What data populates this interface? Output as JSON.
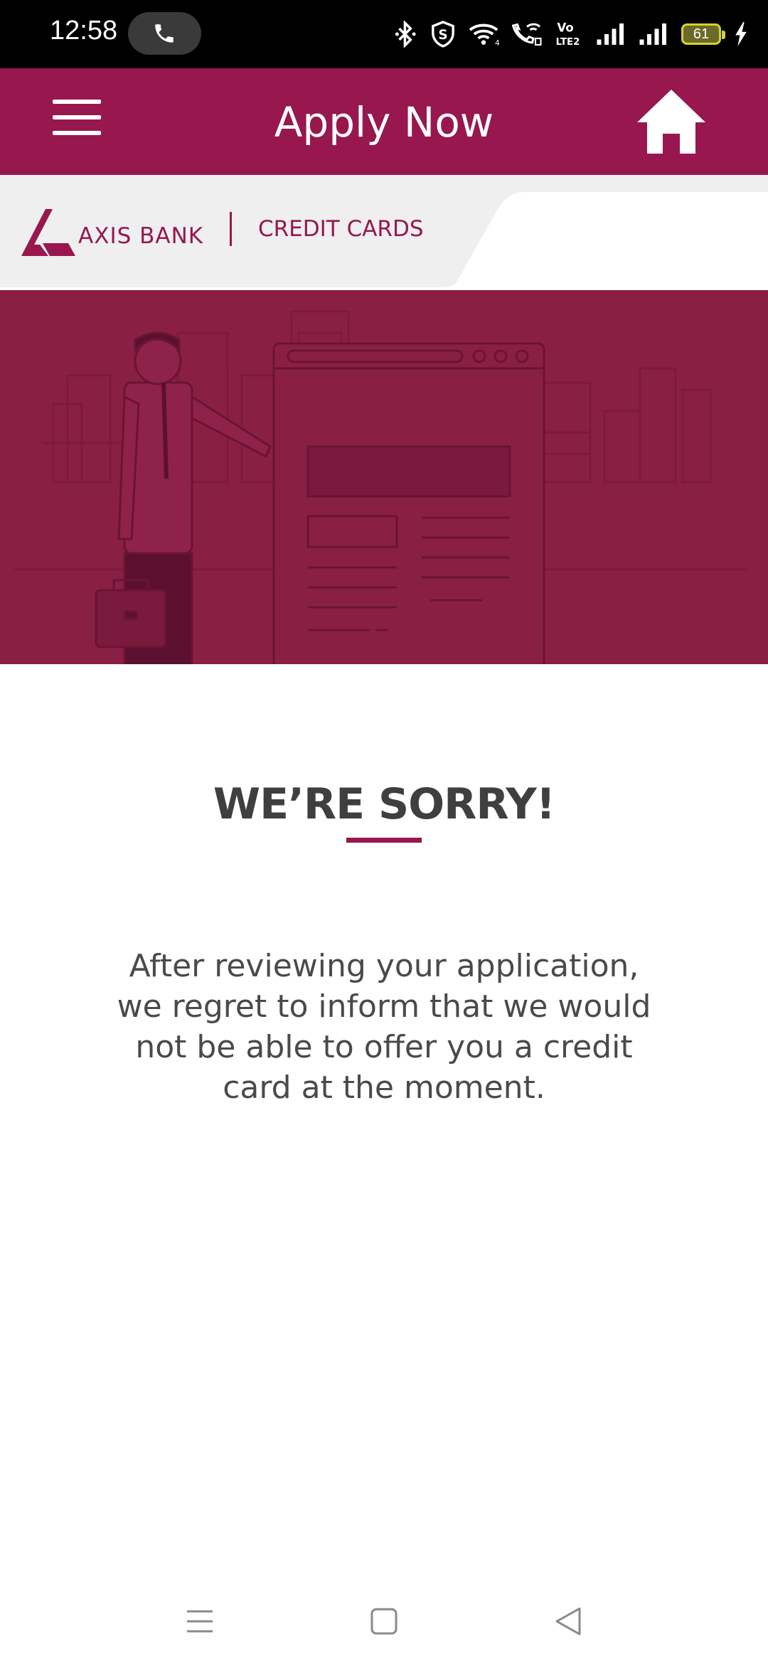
{
  "status_bar": {
    "time": "12:58",
    "battery_level": "61",
    "icons": [
      "phone-icon",
      "bluetooth-icon",
      "shield-s-icon",
      "wifi-icon",
      "wifi-calling-icon",
      "volte-icon",
      "signal-icon",
      "signal-icon",
      "battery-icon",
      "charging-icon"
    ]
  },
  "header": {
    "title": "Apply Now",
    "menu_icon": "hamburger-menu-icon",
    "home_icon": "home-icon",
    "background_color": "#97174e"
  },
  "brand": {
    "bank_name": "AXIS BANK",
    "section": "CREDIT CARDS",
    "brand_color": "#97174e"
  },
  "banner": {
    "illustration": "man-with-briefcase-presenting-application-form"
  },
  "content": {
    "title": "WE’RE SORRY!",
    "message": "After reviewing your application, we regret to inform that we would not be able to offer you a credit card at the moment."
  },
  "nav_bar": {
    "icons": [
      "recent-apps-icon",
      "home-square-icon",
      "back-triangle-icon"
    ]
  }
}
